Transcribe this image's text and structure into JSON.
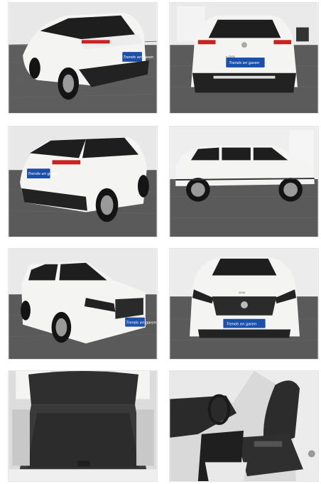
{
  "gallery": {
    "photos": [
      {
        "view": "rear three-quarter left",
        "plate_text": "Trends en garen"
      },
      {
        "view": "rear",
        "plate_text": "Trends en garen",
        "badge": "e-2008"
      },
      {
        "view": "rear three-quarter right",
        "plate_text": "Trends en garen"
      },
      {
        "view": "side profile"
      },
      {
        "view": "front three-quarter left",
        "plate_text": "Trends en garen"
      },
      {
        "view": "front",
        "plate_text": "Trends en garen",
        "badge": "2008"
      },
      {
        "view": "boot interior"
      },
      {
        "view": "front seats interior"
      }
    ]
  },
  "colors": {
    "car_body": "#f4f4f2",
    "studio_wall": "#e9e9e9",
    "floor": "#5a5a5a",
    "plate": "#1c4fa8"
  }
}
